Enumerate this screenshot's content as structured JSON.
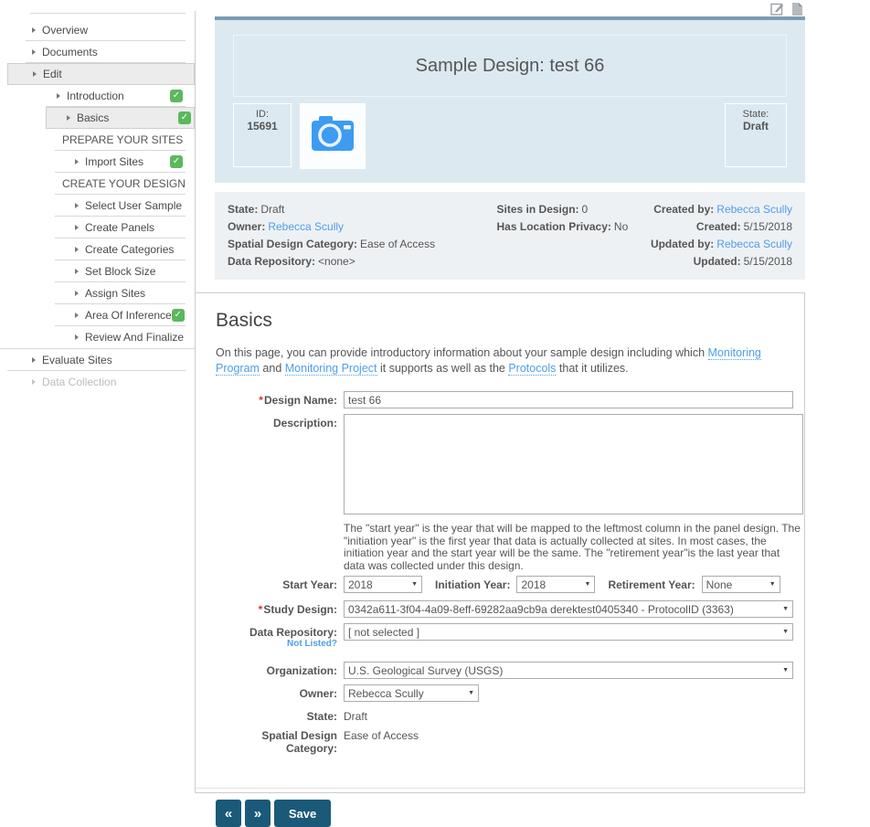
{
  "icons": {
    "check": "✓",
    "select_arrow": "▼"
  },
  "colors": {
    "link": "#4d9eea",
    "check_green": "#5cb85c",
    "button_blue": "#1a5a78",
    "banner_bg": "#dce9f1",
    "banner_top_border": "#7b9cb2",
    "meta_bg": "#eef1f4",
    "camera_blue": "#3d9bf0"
  },
  "sidebar": {
    "items": [
      {
        "label": "Overview"
      },
      {
        "label": "Documents"
      },
      {
        "label": "Edit"
      },
      {
        "label": "Introduction"
      },
      {
        "label": "Basics"
      },
      {
        "label": "PREPARE YOUR SITES"
      },
      {
        "label": "Import Sites"
      },
      {
        "label": "CREATE YOUR DESIGN"
      },
      {
        "label": "Select User Sample"
      },
      {
        "label": "Create Panels"
      },
      {
        "label": "Create Categories"
      },
      {
        "label": "Set Block Size"
      },
      {
        "label": "Assign Sites"
      },
      {
        "label": "Area Of Inference"
      },
      {
        "label": "Review And Finalize"
      },
      {
        "label": "Evaluate Sites"
      },
      {
        "label": "Data Collection"
      }
    ]
  },
  "banner": {
    "title": "Sample Design: test 66",
    "id_label": "ID:",
    "id_value": "15691",
    "state_label": "State:",
    "state_value": "Draft"
  },
  "meta": {
    "col1": [
      {
        "label": "State:",
        "value": "Draft"
      },
      {
        "label": "Owner:",
        "value": "Rebecca Scully"
      },
      {
        "label": "Spatial Design Category:",
        "value": "Ease of Access"
      },
      {
        "label": "Data Repository:",
        "value": "<none>"
      }
    ],
    "col2": [
      {
        "label": "Sites in Design:",
        "value": "0"
      },
      {
        "label": "Has Location Privacy:",
        "value": "No"
      }
    ],
    "col3": [
      {
        "label": "Created by:",
        "value": "Rebecca Scully"
      },
      {
        "label": "Created:",
        "value": "5/15/2018"
      },
      {
        "label": "Updated by:",
        "value": "Rebecca Scully"
      },
      {
        "label": "Updated:",
        "value": "5/15/2018"
      }
    ]
  },
  "form": {
    "heading": "Basics",
    "required_marker": "*",
    "intro_segments": [
      {
        "text": "On this page, you can provide introductory information about your sample design including which "
      },
      {
        "text": "Monitoring Program"
      },
      {
        "text": " and "
      },
      {
        "text": "Monitoring Project"
      },
      {
        "text": " it supports as well as the "
      },
      {
        "text": "Protocols"
      },
      {
        "text": " that it utilizes."
      }
    ],
    "design_name": {
      "label": "Design Name:",
      "value": "test 66"
    },
    "description": {
      "label": "Description:",
      "value": ""
    },
    "years_help": "The \"start year\" is the year that will be mapped to the leftmost column in the panel design. The \"initiation year\" is the first year that data is actually collected at sites. In most cases, the initiation year and the start year will be the same. The \"retirement year\"is the last year that data was collected under this design.",
    "start_year": {
      "label": "Start Year:",
      "value": "2018"
    },
    "initiation_year": {
      "label": "Initiation Year:",
      "value": "2018"
    },
    "retirement_year": {
      "label": "Retirement Year:",
      "value": "None"
    },
    "study_design": {
      "label": "Study Design:",
      "value": "0342a611-3f04-4a09-8eff-69282aa9cb9a derektest0405340 - ProtocolID (3363)"
    },
    "data_repository": {
      "label": "Data Repository:",
      "sub_link": "Not Listed?",
      "value": "[ not selected ]"
    },
    "organization": {
      "label": "Organization:",
      "value": "U.S. Geological Survey (USGS)"
    },
    "owner": {
      "label": "Owner:",
      "value": "Rebecca Scully"
    },
    "state": {
      "label": "State:",
      "value": "Draft"
    },
    "spatial_category": {
      "label": "Spatial Design Category:",
      "value": "Ease of Access"
    },
    "buttons": {
      "prev": "«",
      "next": "»",
      "save": "Save"
    }
  }
}
